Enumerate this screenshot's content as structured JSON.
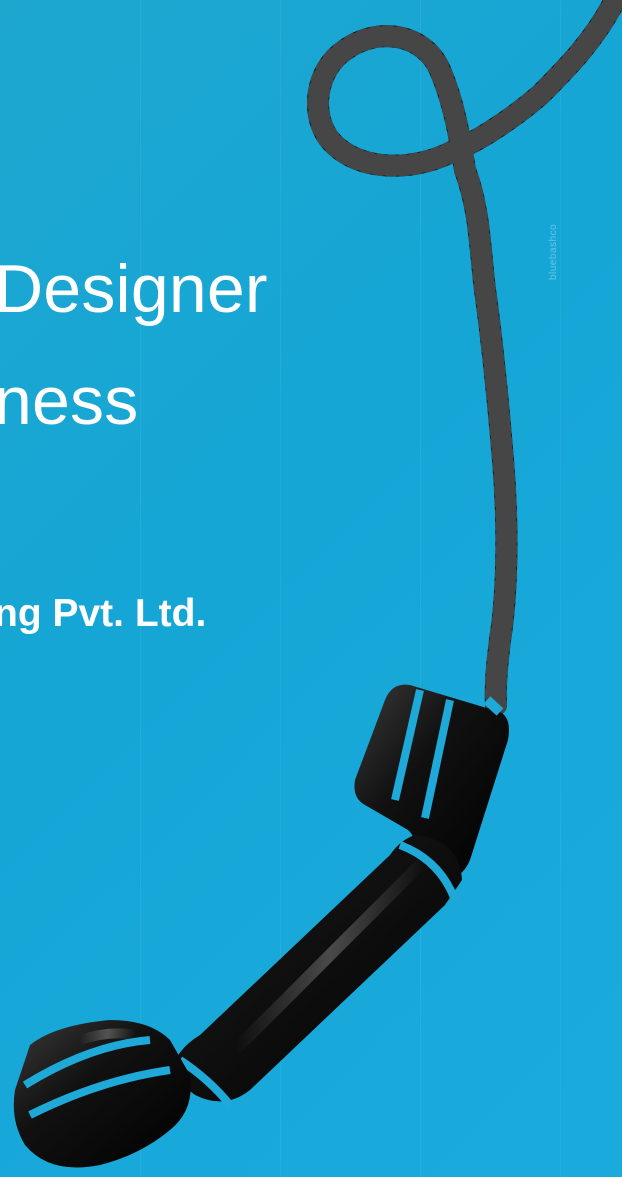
{
  "headline": {
    "line1": "Designer",
    "line2": "ness"
  },
  "company": {
    "name": "ng Pvt. Ltd."
  },
  "watermark": {
    "text": "bluebashco"
  },
  "colors": {
    "background": "#15a6d6",
    "cord": "#111111",
    "band": "#1ea9d8"
  },
  "icons": {
    "phone": "telephone-receiver-icon"
  }
}
